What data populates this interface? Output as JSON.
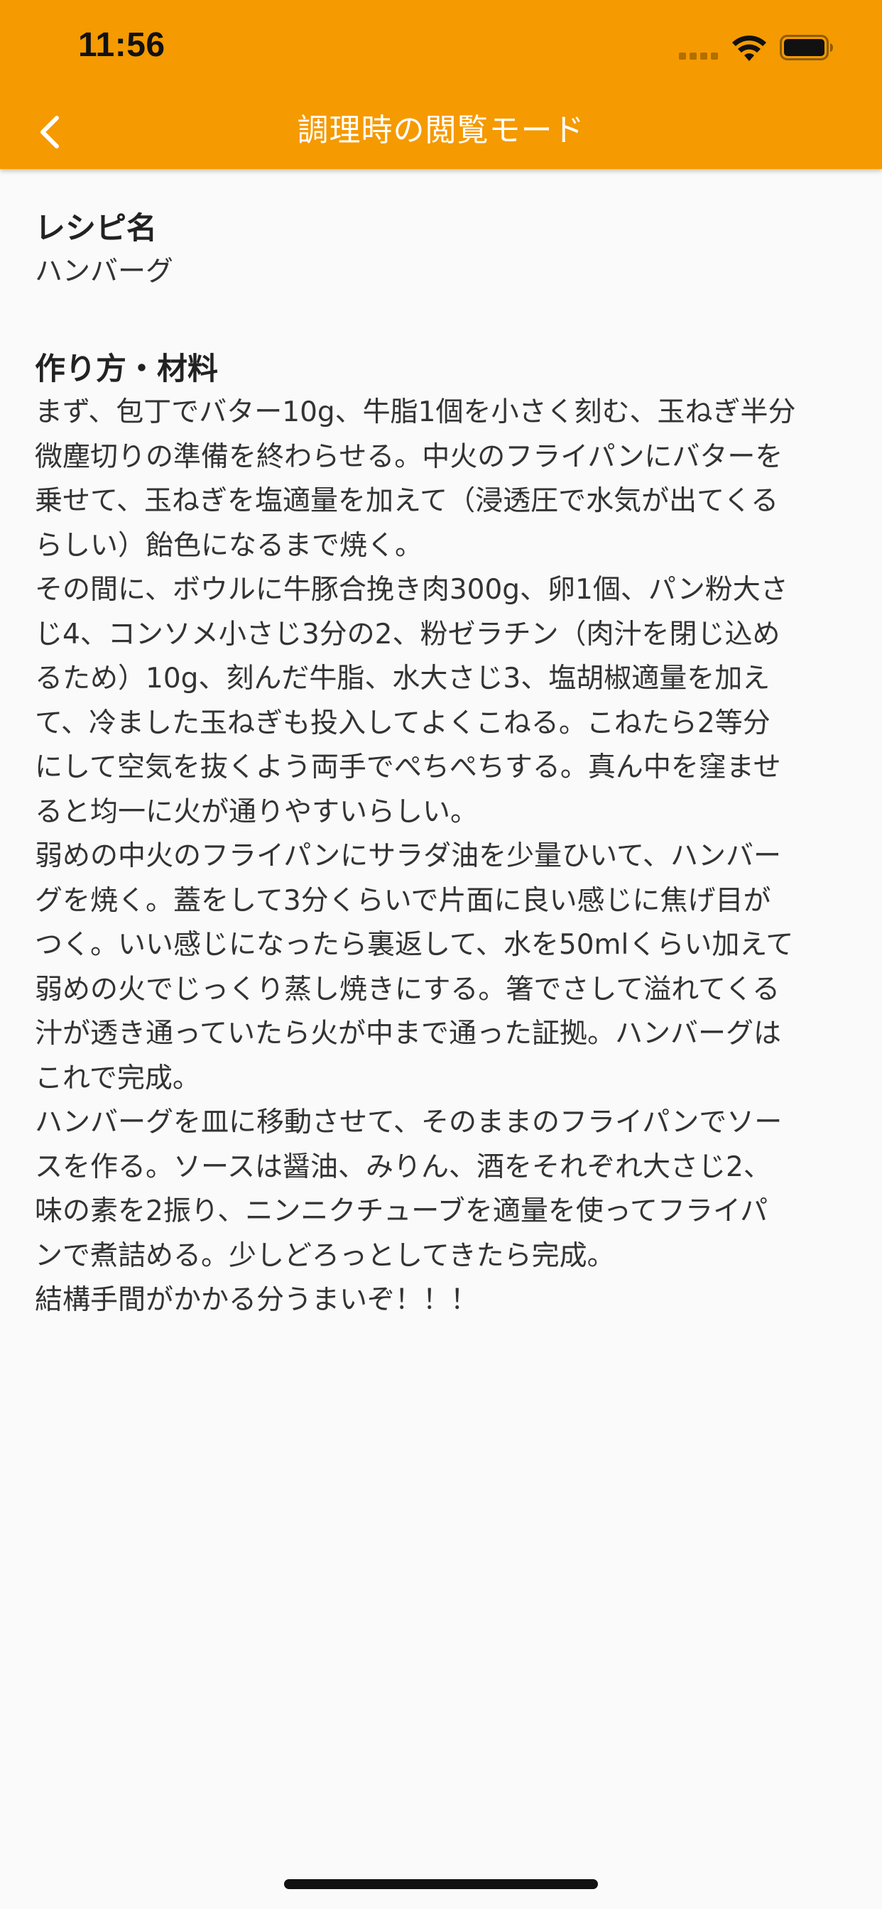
{
  "status_bar": {
    "time": "11:56"
  },
  "nav": {
    "title": "調理時の閲覧モード",
    "back_icon": "chevron-left-icon"
  },
  "recipe": {
    "name_heading": "レシピ名",
    "name": "ハンバーグ",
    "steps_heading": "作り方・材料",
    "steps_lines": [
      "まず、包丁でバター10g、牛脂1個を小さく刻む、玉ねぎ半分",
      "微塵切りの準備を終わらせる。中火のフライパンにバターを",
      "乗せて、玉ねぎを塩適量を加えて（浸透圧で水気が出てくる",
      "らしい）飴色になるまで焼く。",
      "その間に、ボウルに牛豚合挽き肉300g、卵1個、パン粉大さ",
      "じ4、コンソメ小さじ3分の2、粉ゼラチン（肉汁を閉じ込め",
      "るため）10g、刻んだ牛脂、水大さじ3、塩胡椒適量を加え",
      "て、冷ました玉ねぎも投入してよくこねる。こねたら2等分",
      "にして空気を抜くよう両手でぺちぺちする。真ん中を窪ませ",
      "ると均一に火が通りやすいらしい。",
      "弱めの中火のフライパンにサラダ油を少量ひいて、ハンバー",
      "グを焼く。蓋をして3分くらいで片面に良い感じに焦げ目が",
      "つく。いい感じになったら裏返して、水を50mlくらい加えて",
      "弱めの火でじっくり蒸し焼きにする。箸でさして溢れてくる",
      "汁が透き通っていたら火が中まで通った証拠。ハンバーグは",
      "これで完成。",
      "ハンバーグを皿に移動させて、そのままのフライパンでソー",
      "スを作る。ソースは醤油、みりん、酒をそれぞれ大さじ2、",
      "味の素を2振り、ニンニクチューブを適量を使ってフライパ",
      "ンで煮詰める。少しどろっとしてきたら完成。",
      "結構手間がかかる分うまいぞ！！！"
    ]
  },
  "colors": {
    "app_bar": "#f59a00",
    "background": "#fafafa",
    "title_text": "#ffffff",
    "body_text": "#333333"
  }
}
